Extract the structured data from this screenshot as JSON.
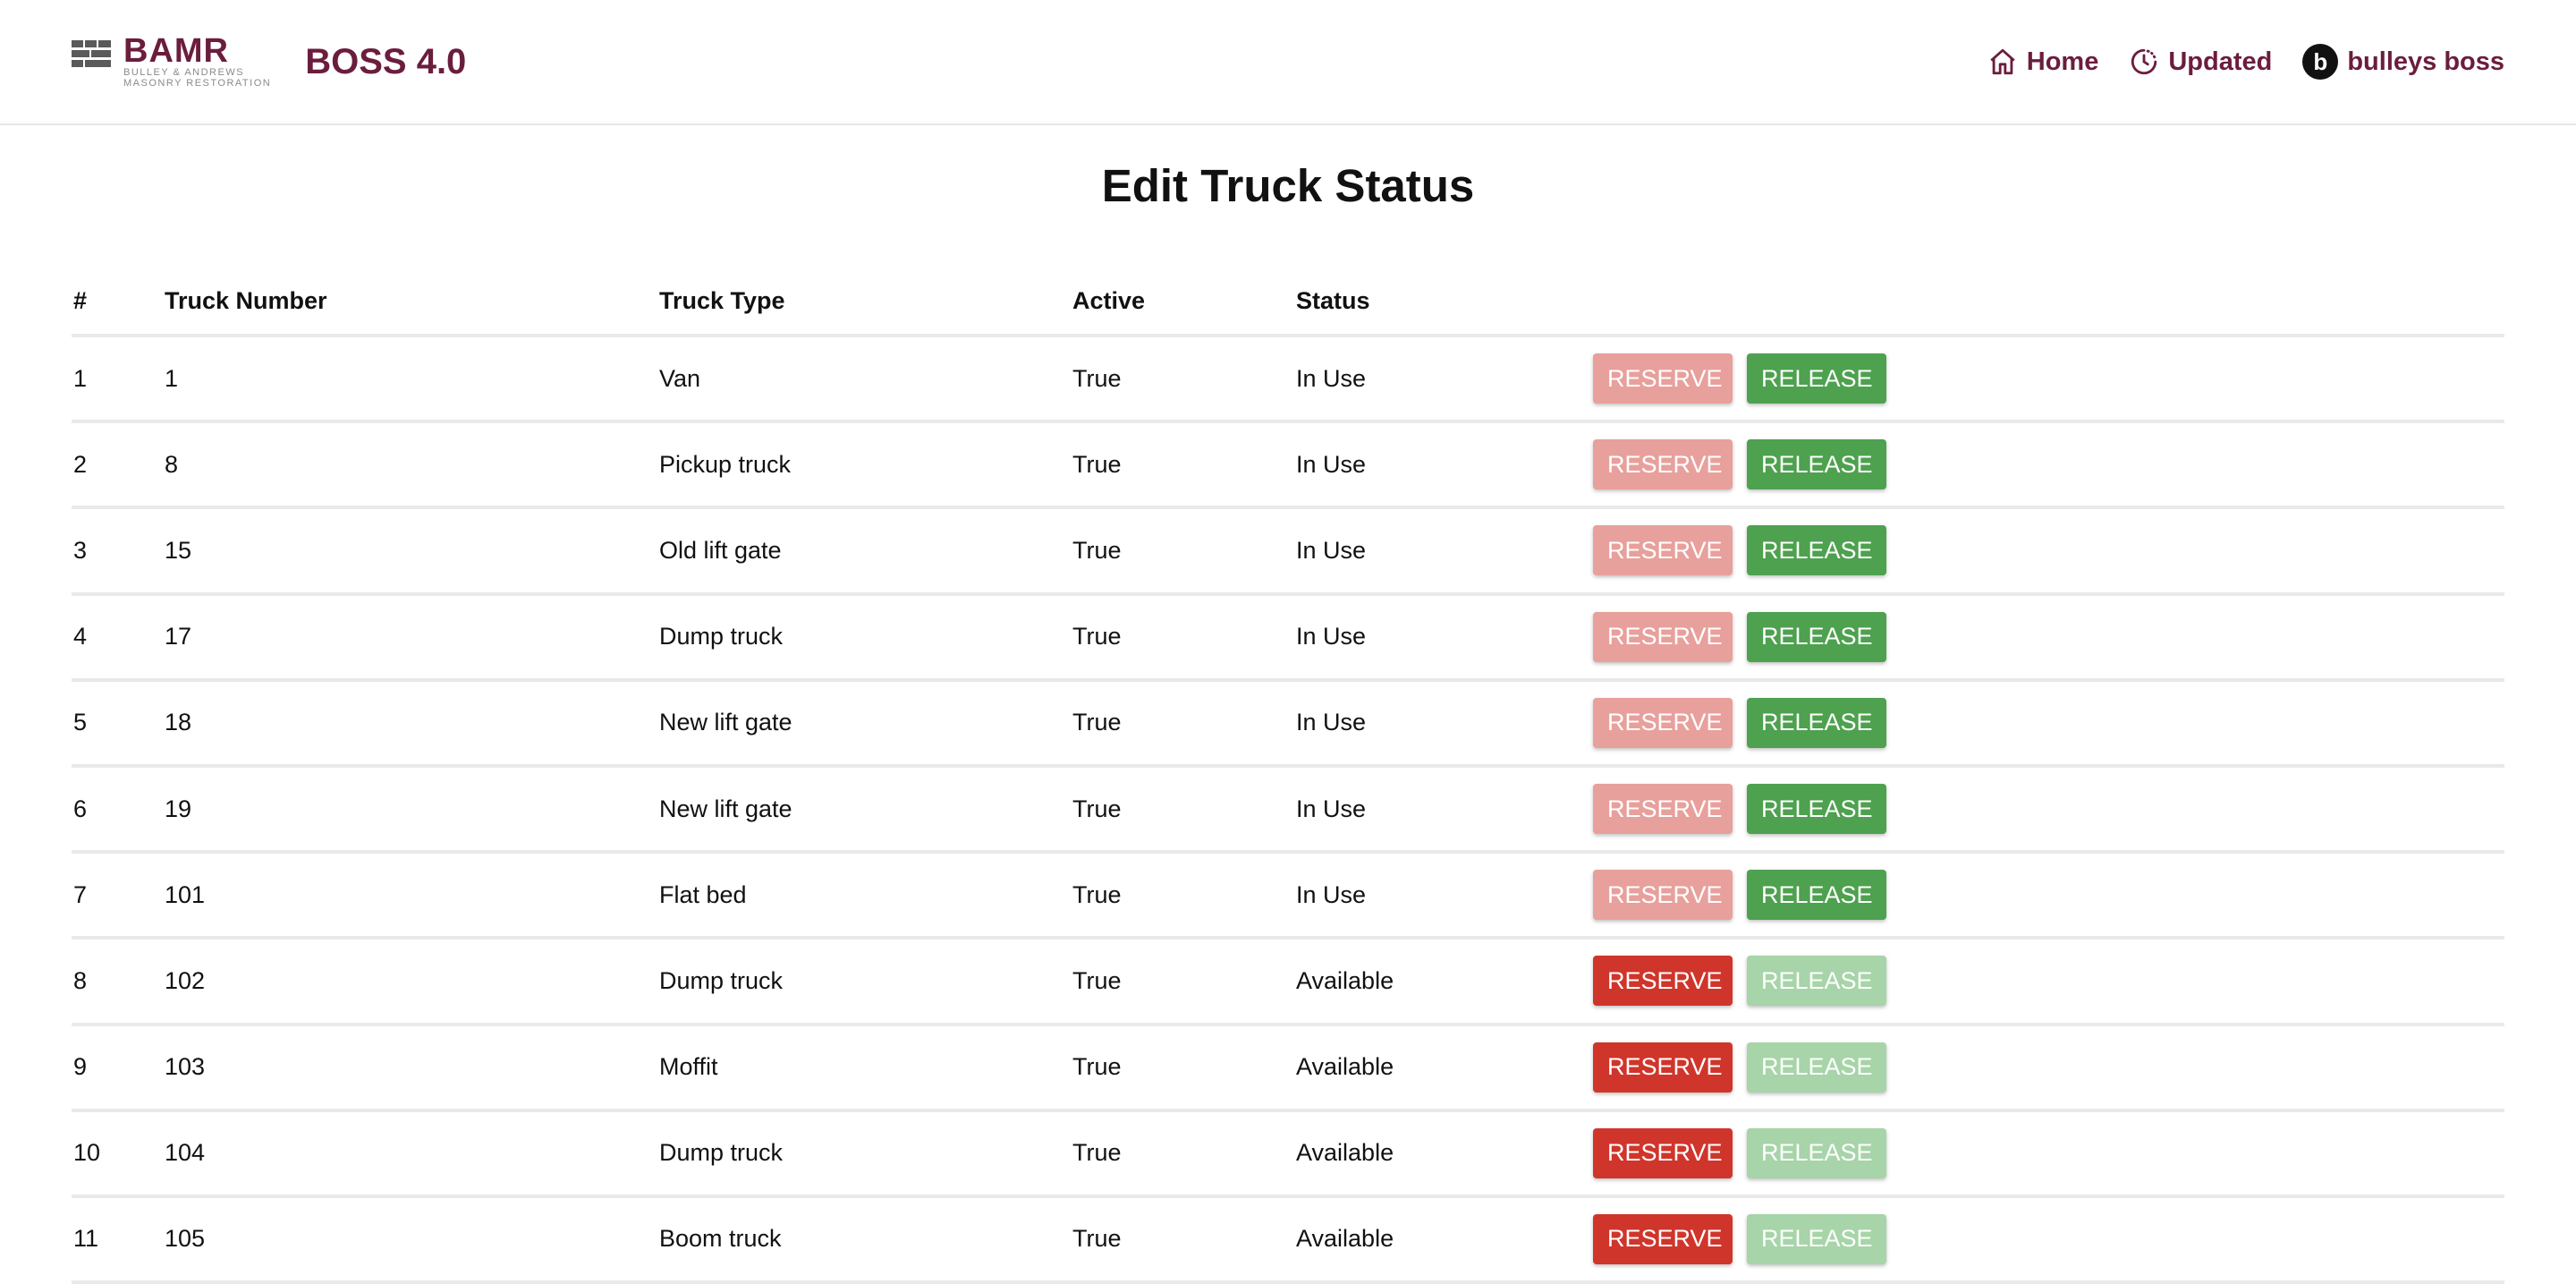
{
  "header": {
    "logo_word": "BAMR",
    "logo_sub_1": "Bulley & Andrews",
    "logo_sub_2": "Masonry Restoration",
    "app_title": "BOSS 4.0",
    "nav": {
      "home_label": "Home",
      "updated_label": "Updated",
      "user_initial": "b",
      "user_label": "bulleys boss"
    }
  },
  "page_title": "Edit Truck Status",
  "table": {
    "headers": [
      "#",
      "Truck Number",
      "Truck Type",
      "Active",
      "Status"
    ],
    "reserve_label": "RESERVE",
    "release_label": "RELEASE",
    "rows": [
      {
        "idx": "1",
        "number": "1",
        "type": "Van",
        "active": "True",
        "status": "In Use"
      },
      {
        "idx": "2",
        "number": "8",
        "type": "Pickup truck",
        "active": "True",
        "status": "In Use"
      },
      {
        "idx": "3",
        "number": "15",
        "type": "Old lift gate",
        "active": "True",
        "status": "In Use"
      },
      {
        "idx": "4",
        "number": "17",
        "type": "Dump truck",
        "active": "True",
        "status": "In Use"
      },
      {
        "idx": "5",
        "number": "18",
        "type": "New lift gate",
        "active": "True",
        "status": "In Use"
      },
      {
        "idx": "6",
        "number": "19",
        "type": "New lift gate",
        "active": "True",
        "status": "In Use"
      },
      {
        "idx": "7",
        "number": "101",
        "type": "Flat bed",
        "active": "True",
        "status": "In Use"
      },
      {
        "idx": "8",
        "number": "102",
        "type": "Dump truck",
        "active": "True",
        "status": "Available"
      },
      {
        "idx": "9",
        "number": "103",
        "type": "Moffit",
        "active": "True",
        "status": "Available"
      },
      {
        "idx": "10",
        "number": "104",
        "type": "Dump truck",
        "active": "True",
        "status": "Available"
      },
      {
        "idx": "11",
        "number": "105",
        "type": "Boom truck",
        "active": "True",
        "status": "Available"
      }
    ]
  },
  "colors": {
    "brand": "#6b1d3d",
    "reserve_enabled": "#d0352b",
    "reserve_disabled": "#e8a09c",
    "release_enabled": "#4ea14f",
    "release_disabled": "#a7d4a8"
  },
  "icons": {
    "logo": "brick-logo-icon",
    "home": "home-icon",
    "updated": "clock-history-icon"
  }
}
